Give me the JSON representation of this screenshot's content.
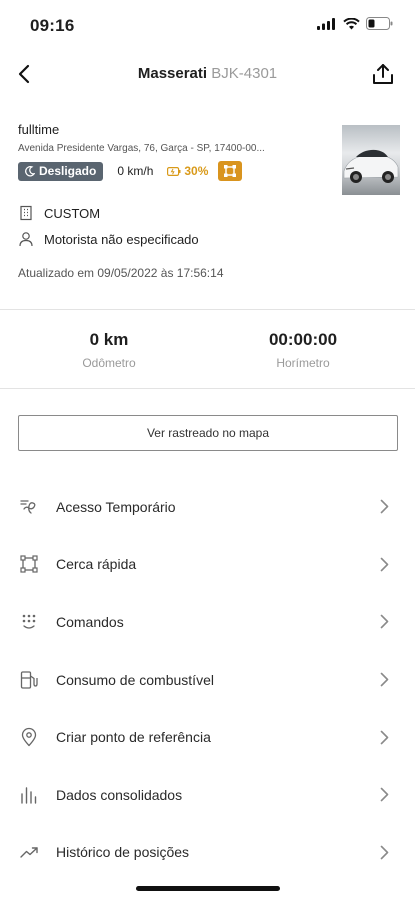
{
  "status_bar": {
    "time": "09:16"
  },
  "header": {
    "title": "Masserati",
    "plate": "BJK-4301"
  },
  "vehicle": {
    "company": "fulltime",
    "address": "Avenida Presidente Vargas, 76, Garça - SP, 17400-00...",
    "status_badge": "Desligado",
    "speed": "0 km/h",
    "battery": "30%",
    "category": "CUSTOM",
    "driver": "Motorista não especificado",
    "updated": "Atualizado em 09/05/2022 às 17:56:14"
  },
  "stats": {
    "odometer_value": "0 km",
    "odometer_label": "Odômetro",
    "hourmeter_value": "00:00:00",
    "hourmeter_label": "Horímetro"
  },
  "map_button": "Ver rastreado no mapa",
  "menu": [
    {
      "label": "Acesso Temporário",
      "icon": "temporary-access-icon"
    },
    {
      "label": "Cerca rápida",
      "icon": "quick-fence-icon"
    },
    {
      "label": "Comandos",
      "icon": "commands-icon"
    },
    {
      "label": "Consumo de combustível",
      "icon": "fuel-icon"
    },
    {
      "label": "Criar ponto de referência",
      "icon": "location-pin-icon"
    },
    {
      "label": "Dados consolidados",
      "icon": "bar-chart-icon"
    },
    {
      "label": "Histórico de posições",
      "icon": "trend-icon"
    }
  ],
  "colors": {
    "status_off": "#5a6570",
    "battery": "#d99a1a",
    "fence": "#d9941e"
  }
}
